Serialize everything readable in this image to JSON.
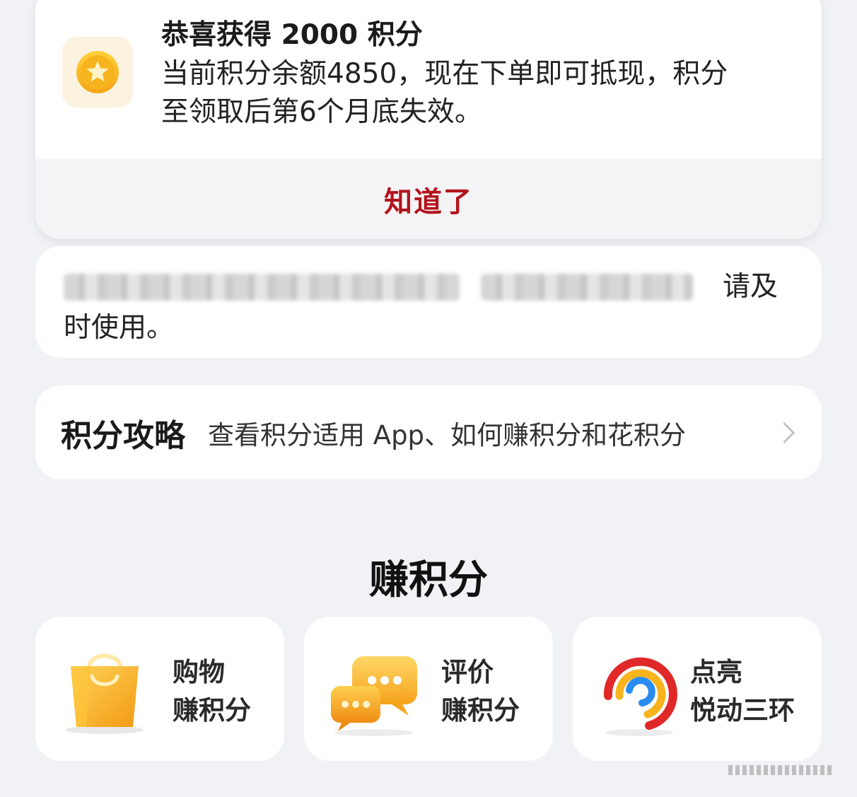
{
  "notice": {
    "title": "恭喜获得 2000 积分",
    "body_line1": "当前积分余额4850，现在下单即可抵现，积分",
    "body_line2": "至领取后第6个月底失效。",
    "ok_label": "知道了",
    "icon": "star-coin-icon",
    "accent_color": "#b3141c"
  },
  "expiry": {
    "tail": "请及",
    "line2": "时使用。"
  },
  "guide": {
    "title": "积分攻略",
    "desc": "查看积分适用 App、如何赚积分和花积分"
  },
  "earn": {
    "section_title": "赚积分",
    "tiles": [
      {
        "line1": "购物",
        "line2": "赚积分",
        "icon": "shopping-bag-icon"
      },
      {
        "line1": "评价",
        "line2": "赚积分",
        "icon": "chat-bubbles-icon"
      },
      {
        "line1": "点亮",
        "line2": "悦动三环",
        "icon": "activity-rings-icon"
      }
    ]
  }
}
